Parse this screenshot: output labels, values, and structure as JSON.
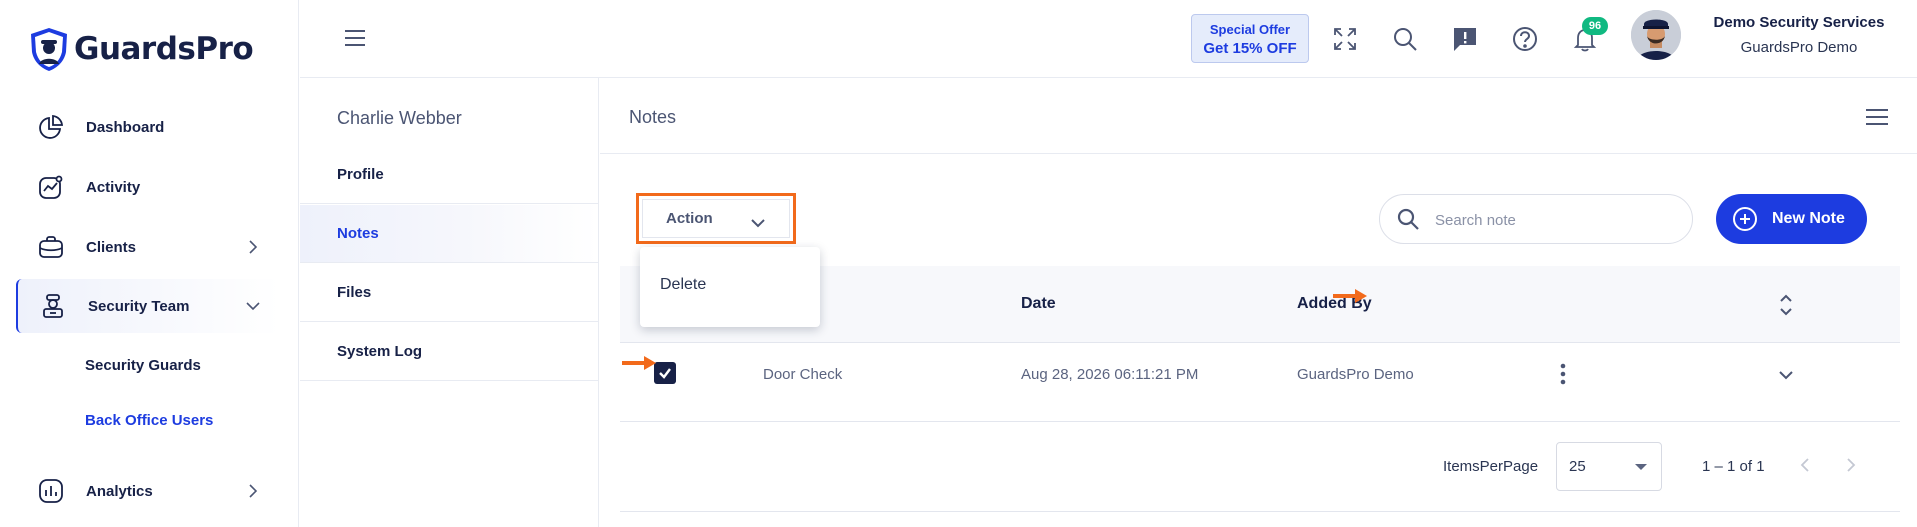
{
  "brand": {
    "name": "GuardsPro"
  },
  "sidebar": {
    "items": [
      {
        "label": "Dashboard",
        "icon": "pie-chart-icon"
      },
      {
        "label": "Activity",
        "icon": "activity-chart-icon"
      },
      {
        "label": "Clients",
        "icon": "briefcase-icon"
      },
      {
        "label": "Security Team",
        "icon": "guard-icon"
      },
      {
        "label": "Analytics",
        "icon": "bar-chart-icon"
      }
    ],
    "subitems": [
      {
        "label": "Security Guards"
      },
      {
        "label": "Back Office Users"
      }
    ]
  },
  "topbar": {
    "offer_line1": "Special Offer",
    "offer_line2": "Get 15% OFF",
    "notification_count": "96",
    "user_name": "Demo Security Services",
    "user_sub": "GuardsPro Demo"
  },
  "subpanel": {
    "person_name": "Charlie Webber",
    "items": [
      {
        "label": "Profile"
      },
      {
        "label": "Notes"
      },
      {
        "label": "Files"
      },
      {
        "label": "System Log"
      }
    ]
  },
  "main": {
    "title": "Notes",
    "action_label": "Action",
    "dropdown_items": [
      {
        "label": "Delete"
      }
    ],
    "search_placeholder": "Search note",
    "new_note_label": "New Note",
    "columns": {
      "date": "Date",
      "added_by": "Added By"
    },
    "rows": [
      {
        "title": "Door Check",
        "date": "Aug 28, 2026 06:11:21 PM",
        "added_by": "GuardsPro Demo",
        "checked": true
      }
    ],
    "pager": {
      "label": "ItemsPerPage",
      "per_page": "25",
      "range": "1 – 1 of 1"
    }
  },
  "colors": {
    "accent": "#1d3ce0",
    "highlight": "#f26a1b",
    "badge": "#10b981",
    "navy": "#172147"
  }
}
